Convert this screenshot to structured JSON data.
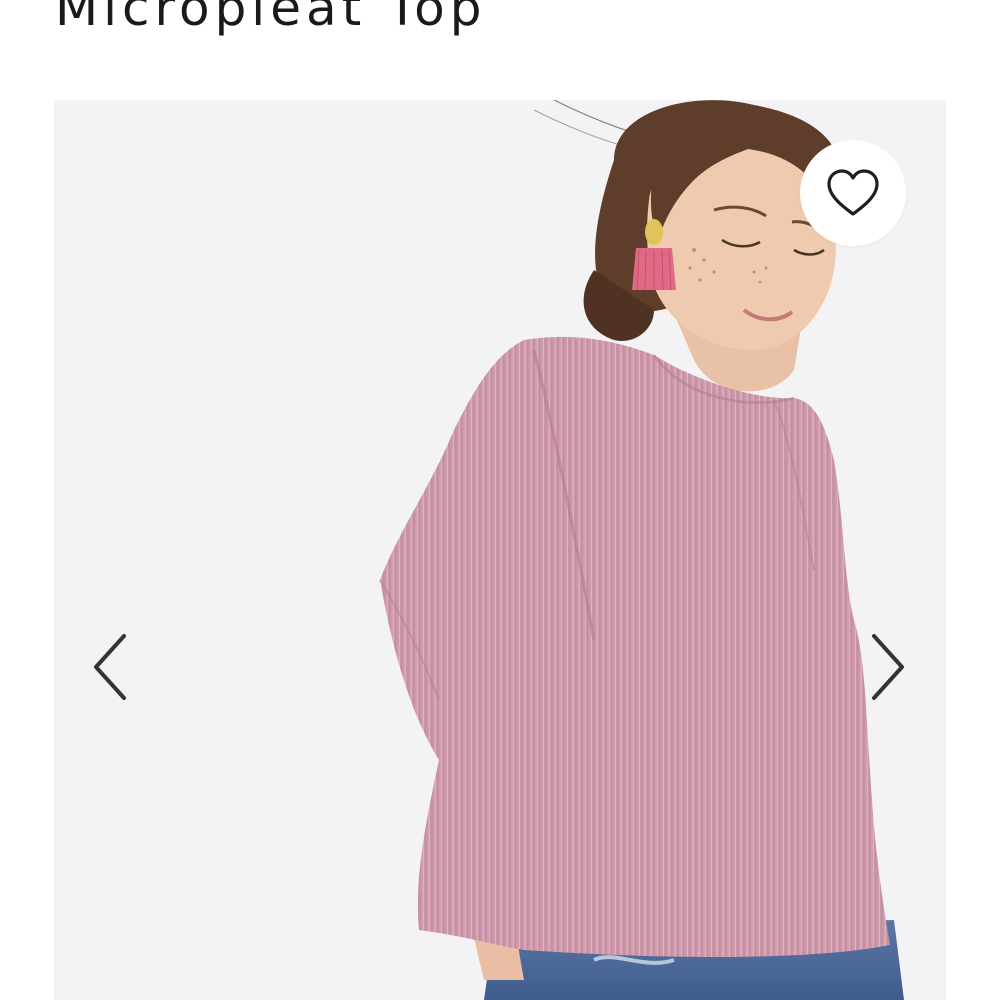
{
  "product": {
    "title": "Micropleat Top"
  },
  "gallery": {
    "prev_icon": "chevron-left-icon",
    "next_icon": "chevron-right-icon",
    "favorite_icon": "heart-outline-icon"
  },
  "colors": {
    "background": "#ffffff",
    "image_backdrop": "#f3f3f5",
    "top_color": "#cf9cac",
    "icon_color": "#333333"
  }
}
